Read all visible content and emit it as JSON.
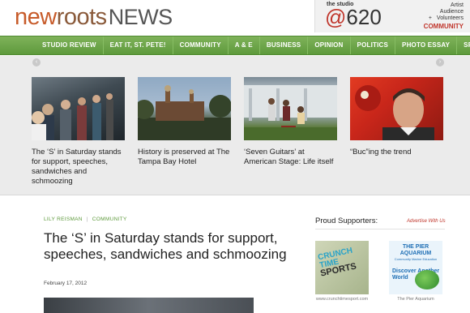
{
  "header": {
    "logo": {
      "part1": "new",
      "part2": "roots",
      "part3": "NEWS"
    },
    "studio": {
      "small": "the studio",
      "at": "@",
      "number": "620",
      "right_lines": [
        "Artist",
        "Audience",
        "Volunteers"
      ],
      "plus": "+",
      "community": "COMMUNITY"
    }
  },
  "nav": {
    "items": [
      "STUDIO REVIEW",
      "EAT IT, ST. PETE!",
      "COMMUNITY",
      "A & E",
      "BUSINESS",
      "OPINION",
      "POLITICS",
      "PHOTO ESSAY",
      "SPORTS"
    ]
  },
  "carousel": {
    "prev": "‹",
    "next": "›",
    "slides": [
      {
        "caption": "The ‘S’ in Saturday stands for support, speeches, sandwiches and schmoozing"
      },
      {
        "caption": "History is preserved at The Tampa Bay Hotel"
      },
      {
        "caption": "‘Seven Guitars’ at American Stage: Life itself"
      },
      {
        "caption": "“Buc”ing the trend"
      }
    ]
  },
  "article": {
    "author": "LILY REISMAN",
    "category": "COMMUNITY",
    "headline": "The ‘S’ in Saturday stands for support, speeches, sandwiches and schmoozing",
    "date": "February 17, 2012"
  },
  "sidebar": {
    "title": "Proud Supporters:",
    "advertise": "Advertise With Us",
    "sponsors": [
      {
        "line1": "CRUNCH TIME",
        "line2": "SPORTS",
        "caption": "www.crunchtimesport.com"
      },
      {
        "line1": "THE PIER AQUARIUM",
        "line2": "Community Marine Education",
        "line3": "Discover Another World",
        "caption": "The Pier Aquarium"
      }
    ]
  },
  "colors": {
    "nav_green": "#5e9a3c",
    "accent_red": "#c0362c",
    "logo_orange": "#c75b2a"
  }
}
